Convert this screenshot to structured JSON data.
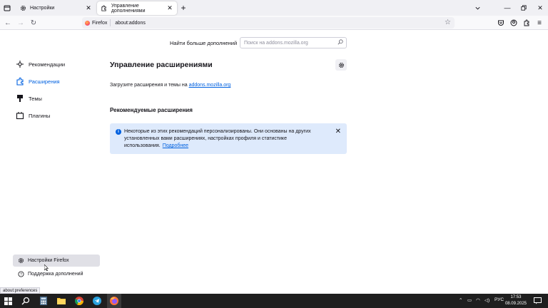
{
  "tabs": [
    {
      "label": "Настройки",
      "icon": "gear-icon"
    },
    {
      "label": "Управление дополнениями",
      "icon": "puzzle-icon",
      "active": true
    }
  ],
  "urlbar": {
    "identity": "Firefox",
    "url": "about:addons"
  },
  "header": {
    "find_more_label": "Найти больше дополнений",
    "search_placeholder": "Поиск на addons.mozilla.org"
  },
  "sidebar": {
    "items": [
      {
        "label": "Рекомендации",
        "icon": "sparkle-icon"
      },
      {
        "label": "Расширения",
        "icon": "puzzle-icon",
        "selected": true
      },
      {
        "label": "Темы",
        "icon": "brush-icon"
      },
      {
        "label": "Плагины",
        "icon": "plugin-icon"
      }
    ],
    "footer": [
      {
        "label": "Настройки Firefox",
        "icon": "gear-icon"
      },
      {
        "label": "Поддержка дополнений",
        "icon": "help-icon"
      }
    ]
  },
  "main": {
    "title": "Управление расширениями",
    "intro_text": "Загрузите расширения и темы на ",
    "intro_link": "addons.mozilla.org",
    "recommended_title": "Рекомендуемые расширения",
    "notice_text": "Некоторые из этих рекомендаций персонализированы. Они основаны на других установленных вами расширениях, настройках профиля и статистике использования.",
    "notice_link": "Подробнее"
  },
  "status_link": "about:preferences",
  "taskbar": {
    "language": "РУС",
    "time": "17:53",
    "date": "08.09.2025"
  },
  "colors": {
    "accent": "#0061e0",
    "notice_bg": "#deeafc",
    "taskbar": "#1f1f1f"
  }
}
